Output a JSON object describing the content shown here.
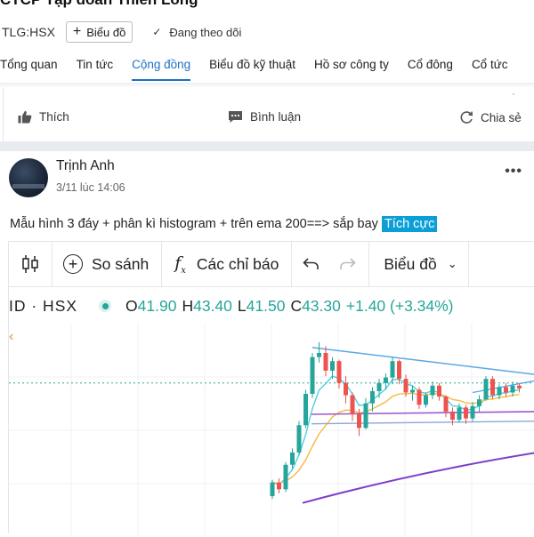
{
  "header": {
    "company_name": "CTCP Tập đoàn Thiên Long",
    "ticker": "TLG:HSX",
    "chart_button": "Biểu đồ",
    "follow_label": "Đang theo dõi"
  },
  "tabs": [
    {
      "label": "Tổng quan"
    },
    {
      "label": "Tin tức"
    },
    {
      "label": "Cộng đồng"
    },
    {
      "label": "Biểu đồ kỹ thuật"
    },
    {
      "label": "Hồ sơ công ty"
    },
    {
      "label": "Cổ đông"
    },
    {
      "label": "Cổ tức"
    }
  ],
  "actions": {
    "like": "Thích",
    "comment": "Bình luận",
    "share": "Chia sẻ"
  },
  "post": {
    "author": "Trịnh Anh",
    "time": "3/11 lúc 14:06",
    "text": "Mẫu hình 3 đáy + phân kì histogram + trên ema 200==> sắp bay",
    "tag": "Tích cực"
  },
  "chart": {
    "toolbar": {
      "compare": "So sánh",
      "indicators": "Các chỉ báo",
      "chart_type": "Biểu đồ"
    },
    "legend": {
      "symbol": "ID · HSX",
      "open_label": "O",
      "open": "41.90",
      "high_label": "H",
      "high": "43.40",
      "low_label": "L",
      "low": "41.50",
      "close_label": "C",
      "close": "43.30",
      "change": "+1.40 (+3.34%)"
    },
    "colors": {
      "up": "#26a69a",
      "down": "#ef5350",
      "trendline": "#5aa7e6",
      "ema_fast": "#4dd0e1",
      "ema_mid": "#f4b942",
      "ema_slow": "#7b3fc8",
      "support": "#9b59d0"
    }
  },
  "chart_data": {
    "type": "candlestick",
    "legend_values": {
      "open": 41.9,
      "high": 43.4,
      "low": 41.5,
      "close": 43.3,
      "change": 1.4,
      "change_pct": 3.34
    },
    "candles": [
      [
        33.0,
        34.2,
        32.8,
        34.0
      ],
      [
        34.0,
        34.3,
        33.2,
        33.5
      ],
      [
        33.5,
        35.5,
        33.3,
        35.3
      ],
      [
        35.3,
        36.5,
        35.0,
        36.2
      ],
      [
        36.2,
        38.5,
        36.0,
        38.2
      ],
      [
        38.2,
        40.8,
        38.0,
        40.5
      ],
      [
        40.5,
        43.5,
        40.2,
        43.2
      ],
      [
        43.2,
        44.3,
        42.8,
        43.5
      ],
      [
        43.5,
        44.0,
        41.8,
        42.2
      ],
      [
        42.2,
        43.2,
        41.6,
        42.9
      ],
      [
        42.9,
        43.0,
        40.9,
        41.3
      ],
      [
        41.3,
        41.8,
        39.8,
        40.4
      ],
      [
        40.4,
        40.6,
        38.5,
        39.0
      ],
      [
        39.0,
        39.4,
        37.4,
        38.0
      ],
      [
        38.0,
        40.2,
        37.9,
        39.8
      ],
      [
        39.8,
        41.0,
        39.2,
        40.7
      ],
      [
        40.7,
        41.6,
        40.2,
        41.3
      ],
      [
        41.3,
        42.0,
        40.8,
        41.7
      ],
      [
        41.7,
        43.2,
        41.2,
        42.9
      ],
      [
        42.9,
        43.0,
        41.2,
        41.6
      ],
      [
        41.6,
        41.9,
        40.3,
        40.6
      ],
      [
        40.6,
        41.1,
        40.0,
        40.8
      ],
      [
        40.8,
        41.0,
        39.4,
        39.7
      ],
      [
        39.7,
        40.6,
        39.5,
        40.4
      ],
      [
        40.4,
        41.4,
        40.1,
        41.1
      ],
      [
        41.1,
        41.3,
        40.0,
        40.3
      ],
      [
        40.3,
        40.4,
        38.8,
        39.2
      ],
      [
        39.2,
        39.5,
        38.2,
        38.6
      ],
      [
        38.6,
        39.8,
        38.4,
        39.5
      ],
      [
        39.5,
        39.7,
        38.3,
        38.7
      ],
      [
        38.7,
        39.9,
        38.5,
        39.6
      ],
      [
        39.6,
        40.4,
        39.2,
        40.1
      ],
      [
        40.1,
        41.8,
        40.0,
        41.6
      ],
      [
        41.6,
        41.8,
        40.1,
        40.4
      ],
      [
        40.4,
        41.2,
        40.1,
        41.0
      ],
      [
        41.0,
        41.3,
        40.3,
        40.6
      ],
      [
        40.6,
        41.4,
        40.3,
        41.1
      ],
      [
        41.1,
        41.3,
        40.6,
        40.9
      ]
    ]
  }
}
